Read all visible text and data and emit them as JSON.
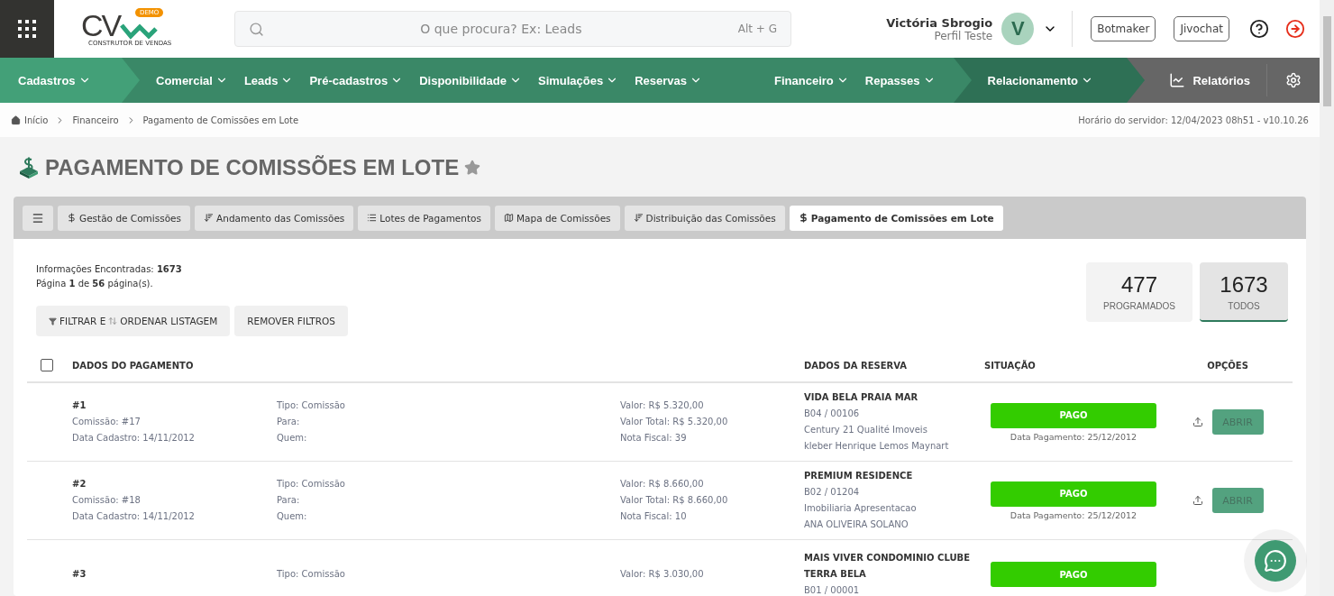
{
  "header": {
    "logo": {
      "text": "CV",
      "badge": "DEMO",
      "tagline": "CONSTRUTOR DE VENDAS"
    },
    "search": {
      "placeholder": "O que procura? Ex: Leads",
      "shortcut": "Alt + G"
    },
    "user": {
      "name": "Victória Sbrogio",
      "role": "Perfil Teste",
      "initial": "V"
    },
    "buttons": [
      "Botmaker",
      "Jivochat"
    ]
  },
  "nav": {
    "sections": [
      {
        "kind": "light",
        "items": [
          "Cadastros"
        ]
      },
      {
        "kind": "mid",
        "items": [
          "Comercial",
          "Leads",
          "Pré-cadastros",
          "Disponibilidade",
          "Simulações",
          "Reservas"
        ]
      },
      {
        "kind": "mid",
        "items": [
          "Financeiro",
          "Repasses"
        ]
      },
      {
        "kind": "dark",
        "items": [
          "Relacionamento"
        ]
      }
    ],
    "reports": "Relatórios"
  },
  "breadcrumb": {
    "items": [
      "Início",
      "Financeiro",
      "Pagamento de Comissões em Lote"
    ],
    "server_time": "Horário do servidor: 12/04/2023 08h51 - v10.10.26"
  },
  "page": {
    "title": "PAGAMENTO DE COMISSÕES EM LOTE",
    "favorite": false
  },
  "tabs": [
    {
      "kind": "menu",
      "selected": false
    },
    {
      "kind": "dollar",
      "label": "Gestão de Comissões",
      "selected": false
    },
    {
      "kind": "sort",
      "label": "Andamento das Comissões",
      "selected": false
    },
    {
      "kind": "list",
      "label": "Lotes de Pagamentos",
      "selected": false
    },
    {
      "kind": "map",
      "label": "Mapa de Comissões",
      "selected": false
    },
    {
      "kind": "sort",
      "label": "Distribuição das Comissões",
      "selected": false
    },
    {
      "kind": "dollar",
      "label": "Pagamento de Comissões em Lote",
      "selected": true
    }
  ],
  "summary": {
    "found": "Informações Encontradas: **1673**",
    "page": "Página **1** de **56** página(s)."
  },
  "filter_buttons": [
    {
      "kind": "filter",
      "label_1": "FILTRAR E",
      "label_2": "ORDENAR LISTAGEM"
    },
    {
      "kind": "plain",
      "label_1": "REMOVER FILTROS"
    }
  ],
  "counters": [
    {
      "value": "477",
      "label": "PROGRAMADOS",
      "selected": false
    },
    {
      "value": "1673",
      "label": "TODOS",
      "selected": true
    }
  ],
  "table": {
    "select_all": {
      "checked": false
    },
    "columns": [
      "DADOS DO PAGAMENTO",
      "DADOS DA RESERVA",
      "SITUAÇÃO",
      "OPÇÕES"
    ],
    "rows": [
      {
        "number": "#1",
        "commission": "Comissão: #17",
        "date": "Data Cadastro: 14/11/2012",
        "type": "Tipo: Comissão",
        "to": "Para:",
        "who": "Quem:",
        "value": "Valor: R$ 5.320,00",
        "total": "Valor Total: R$ 5.320,00",
        "invoice": "Nota Fiscal: 39",
        "project": "VIDA BELA PRAIA MAR",
        "unit": "B04 / 00106",
        "agency": "Century 21 Qualité Imoveis",
        "client": "kleber Henrique Lemos Maynart",
        "status": "PAGO",
        "color": "#33cc00",
        "payment_date": "Data Pagamento: 25/12/2012",
        "action": "ABRIR"
      },
      {
        "number": "#2",
        "commission": "Comissão: #18",
        "date": "Data Cadastro: 14/11/2012",
        "type": "Tipo: Comissão",
        "to": "Para:",
        "who": "Quem:",
        "value": "Valor: R$ 8.660,00",
        "total": "Valor Total: R$ 8.660,00",
        "invoice": "Nota Fiscal: 10",
        "project": "PREMIUM RESIDENCE",
        "unit": "B02 / 01204",
        "agency": "Imobiliaria Apresentacao",
        "client": "ANA OLIVEIRA SOLANO",
        "status": "PAGO",
        "color": "#33cc00",
        "payment_date": "Data Pagamento: 25/12/2012",
        "action": "ABRIR"
      },
      {
        "number": "#3",
        "type": "Tipo: Comissão",
        "value": "Valor: R$ 3.030,00",
        "project": "MAIS VIVER CONDOMINIO CLUBE TERRA BELA",
        "unit": "B01 / 00001",
        "status": "PAGO",
        "color": "#33cc00"
      }
    ]
  }
}
